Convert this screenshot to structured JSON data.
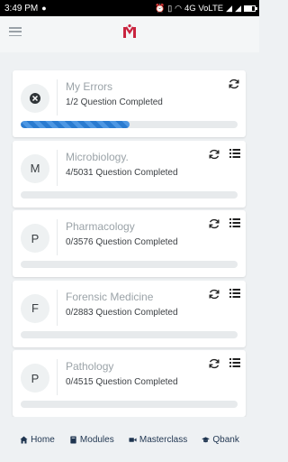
{
  "status_bar": {
    "time": "3:49 PM",
    "network": "4G VoLTE"
  },
  "colors": {
    "accent": "#2a7bd0",
    "logo": "#c9243f",
    "nav_text": "#1f3550"
  },
  "cards": [
    {
      "initial": "",
      "icon": "error-icon",
      "title": "My Errors",
      "subtitle": "1/2 Question Completed",
      "progress": 0.5,
      "show_list_icon": false
    },
    {
      "initial": "M",
      "title": "Microbiology.",
      "subtitle": "4/5031 Question Completed",
      "progress": 0.001,
      "show_list_icon": true
    },
    {
      "initial": "P",
      "title": "Pharmacology",
      "subtitle": "0/3576 Question Completed",
      "progress": 0,
      "show_list_icon": true
    },
    {
      "initial": "F",
      "title": "Forensic Medicine",
      "subtitle": "0/2883 Question Completed",
      "progress": 0,
      "show_list_icon": true
    },
    {
      "initial": "P",
      "title": "Pathology",
      "subtitle": "0/4515 Question Completed",
      "progress": 0,
      "show_list_icon": true
    }
  ],
  "bottom_nav": [
    {
      "label": "Home",
      "icon": "home-icon"
    },
    {
      "label": "Modules",
      "icon": "book-icon"
    },
    {
      "label": "Masterclass",
      "icon": "video-icon"
    },
    {
      "label": "Qbank",
      "icon": "graduation-cap-icon"
    }
  ]
}
